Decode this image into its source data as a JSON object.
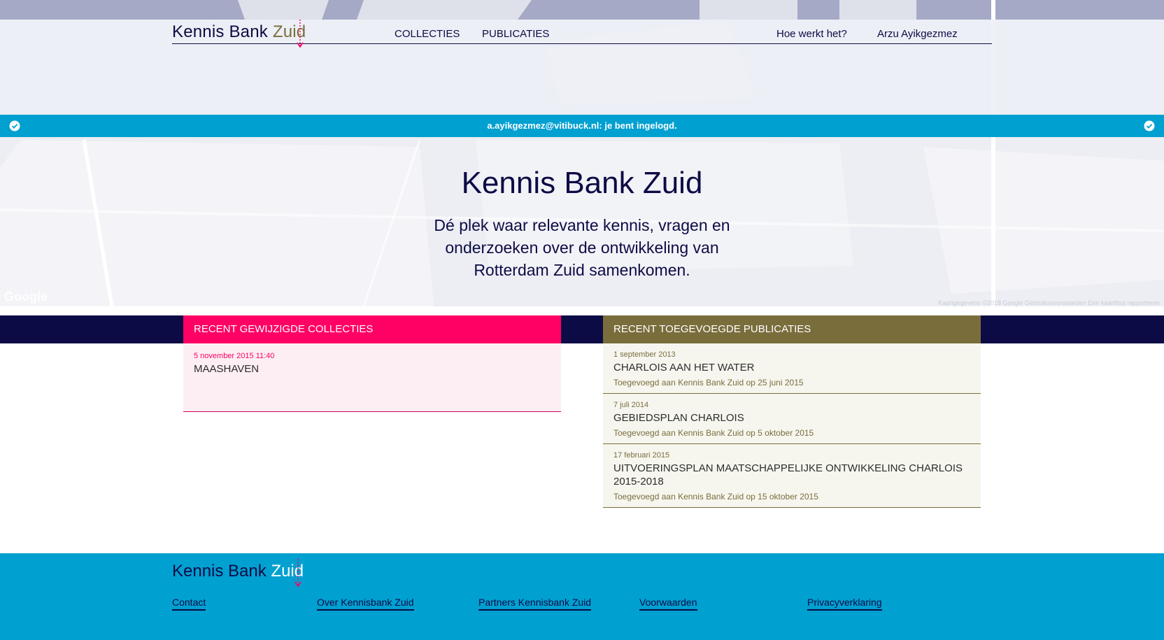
{
  "colors": {
    "navy": "#0d0b45",
    "magenta": "#ff0065",
    "olive": "#7a6d3c",
    "cyan": "#00a0d1"
  },
  "header": {
    "logo_main": "Kennis Bank ",
    "logo_accent": "Zuid",
    "nav": [
      "COLLECTIES",
      "PUBLICATIES"
    ],
    "help_link": "Hoe werkt het?",
    "user_name": "Arzu Ayikgezmez"
  },
  "banner": {
    "message": "a.ayikgezmez@vitibuck.nl: je bent ingelogd.",
    "icon": "check-circle-icon"
  },
  "hero": {
    "title": "Kennis Bank Zuid",
    "subtitle": "Dé plek waar relevante kennis, vragen en onderzoeken over de ontwikkeling van Rotterdam Zuid samenkomen.",
    "map_brand": "Google",
    "map_attribution": "Kaartgegevens ©2018 Google   Gebruiksvoorwaarden   Een kaartfout rapporteren"
  },
  "collections": {
    "heading": "RECENT GEWIJZIGDE COLLECTIES",
    "items": [
      {
        "date": "5 november 2015 11:40",
        "title": "MAASHAVEN"
      }
    ]
  },
  "publications": {
    "heading": "RECENT TOEGEVOEGDE PUBLICATIES",
    "items": [
      {
        "date": "1 september 2013",
        "title": "CHARLOIS AAN HET WATER",
        "added": "Toegevoegd aan Kennis Bank Zuid op 25 juni 2015"
      },
      {
        "date": "7 juli 2014",
        "title": "GEBIEDSPLAN CHARLOIS",
        "added": "Toegevoegd aan Kennis Bank Zuid op 5 oktober 2015"
      },
      {
        "date": "17 februari 2015",
        "title": "UITVOERINGSPLAN MAATSCHAPPELIJKE ONTWIKKELING CHARLOIS 2015-2018",
        "added": "Toegevoegd aan Kennis Bank Zuid op 15 oktober 2015"
      }
    ]
  },
  "footer": {
    "logo_main": "Kennis Bank ",
    "logo_accent": "Zuid",
    "links": [
      "Contact",
      "Over Kennisbank Zuid",
      "Partners Kennisbank Zuid",
      "Voorwaarden",
      "Privacyverklaring"
    ]
  }
}
